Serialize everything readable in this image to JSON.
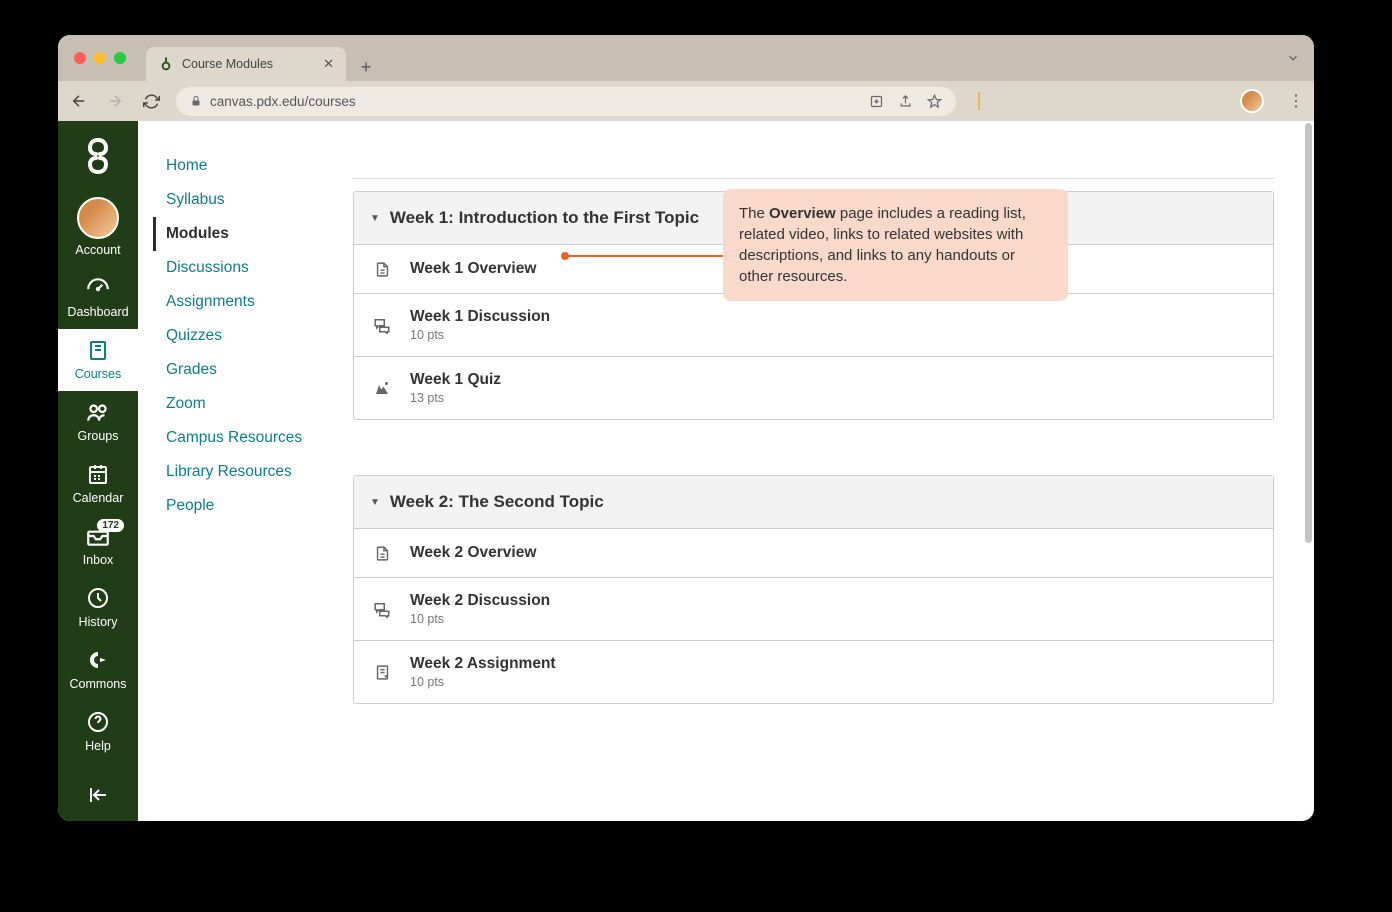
{
  "browser": {
    "tab_title": "Course Modules",
    "url": "canvas.pdx.edu/courses"
  },
  "global_nav": {
    "items": [
      {
        "label": "Account"
      },
      {
        "label": "Dashboard"
      },
      {
        "label": "Courses"
      },
      {
        "label": "Groups"
      },
      {
        "label": "Calendar"
      },
      {
        "label": "Inbox",
        "badge": "172"
      },
      {
        "label": "History"
      },
      {
        "label": "Commons"
      },
      {
        "label": "Help"
      }
    ]
  },
  "course_nav": {
    "items": [
      "Home",
      "Syllabus",
      "Modules",
      "Discussions",
      "Assignments",
      "Quizzes",
      "Grades",
      "Zoom",
      "Campus Resources",
      "Library Resources",
      "People"
    ],
    "active": "Modules"
  },
  "modules": [
    {
      "title": "Week 1: Introduction to the First Topic",
      "items": [
        {
          "type": "page",
          "title": "Week 1 Overview"
        },
        {
          "type": "discussion",
          "title": "Week 1 Discussion",
          "meta": "10 pts"
        },
        {
          "type": "quiz",
          "title": "Week 1 Quiz",
          "meta": "13 pts"
        }
      ]
    },
    {
      "title": "Week 2: The Second Topic",
      "items": [
        {
          "type": "page",
          "title": "Week 2 Overview"
        },
        {
          "type": "discussion",
          "title": "Week 2 Discussion",
          "meta": "10 pts"
        },
        {
          "type": "assignment",
          "title": "Week 2 Assignment",
          "meta": "10 pts"
        }
      ]
    }
  ],
  "callout": {
    "before": "The ",
    "bold": "Overview",
    "after": " page includes a reading list, related video, links to related websites with descriptions, and links to any handouts or other resources."
  }
}
